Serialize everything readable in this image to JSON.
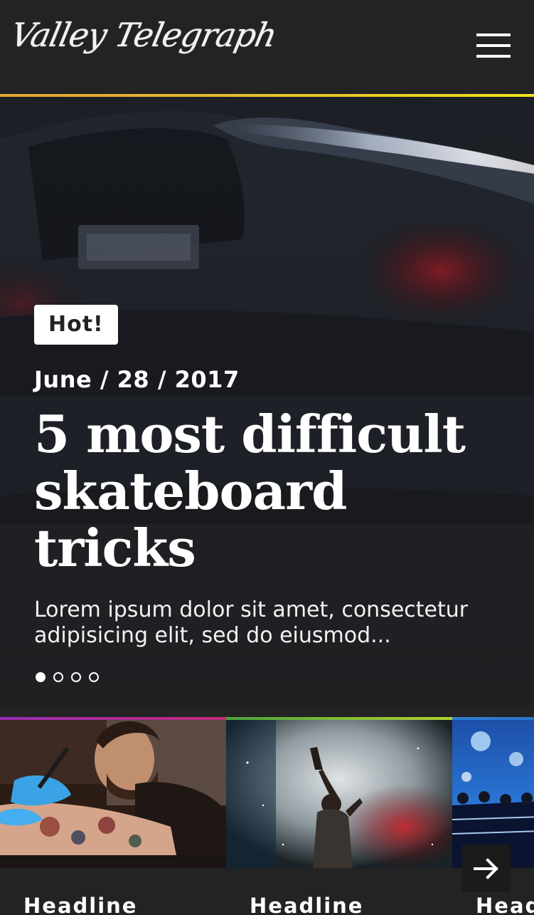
{
  "header": {
    "logo_text": "Valley Telegraph",
    "menu_icon": "hamburger-menu-icon"
  },
  "colors": {
    "background": "#232323",
    "header_accent": "#e6bd2e",
    "card_accent_1": "#9b2cb8",
    "card_accent_2": "#7ac142",
    "card_accent_3": "#2f7fd6"
  },
  "hero": {
    "badge": "Hot!",
    "date": "June / 28 / 2017",
    "title": "5 most difficult skateboard tricks",
    "excerpt": "Lorem ipsum dolor sit amet, consectetur adipisicing elit, sed do eiusmod...",
    "slides_total": 4,
    "active_slide": 1
  },
  "cards": [
    {
      "headline": "Headline",
      "image": "tattoo-artist-photo"
    },
    {
      "headline": "Headline",
      "image": "concert-performer-photo"
    },
    {
      "headline": "Headline",
      "image": "stage-crowd-photo"
    }
  ],
  "carousel": {
    "next_icon": "arrow-right-icon"
  }
}
